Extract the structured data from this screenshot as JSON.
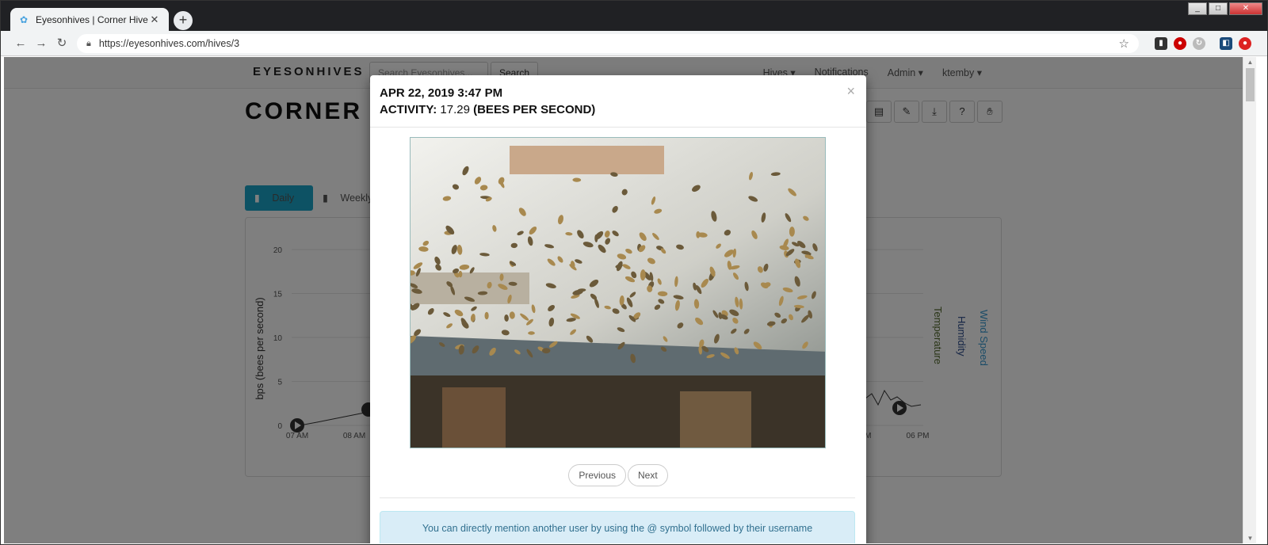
{
  "browser": {
    "tab_title": "Eyesonhives | Corner Hive",
    "url": "https://eyesonhives.com/hives/3",
    "new_tab": "+",
    "window_buttons": [
      "_",
      "□",
      "✕"
    ]
  },
  "navbar": {
    "brand": "EYESONHIVES",
    "search_placeholder": "Search Eyesonhives...",
    "search_button": "Search",
    "links": [
      "Hives ▾",
      "Notifications",
      "Admin ▾",
      "ktemby ▾"
    ]
  },
  "hive": {
    "title": "CORNER H",
    "range_buttons": [
      "Daily",
      "Weekly"
    ]
  },
  "chart_data": {
    "type": "line",
    "ylabel": "bps (bees per second)",
    "ylim": [
      0,
      20
    ],
    "yticks": [
      "0",
      "5",
      "10",
      "15",
      "20"
    ],
    "xticks": [
      "07 AM",
      "08 AM",
      "PM",
      "06 PM"
    ],
    "right_axis_labels": [
      "Temperature",
      "Humidity",
      "Wind Speed"
    ]
  },
  "modal": {
    "date": "APR 22, 2019 3:47 PM",
    "activity_label": "ACTIVITY:",
    "activity_value": "17.29",
    "activity_unit": "(BEES PER SECOND)",
    "close": "×",
    "prev": "Previous",
    "next": "Next",
    "info": "You can directly mention another user by using the @ symbol followed by their username"
  },
  "colors": {
    "accent": "#1aa5c8",
    "temperature": "#556b2f",
    "humidity": "#2a4a8a",
    "wind": "#3a9ad0"
  }
}
